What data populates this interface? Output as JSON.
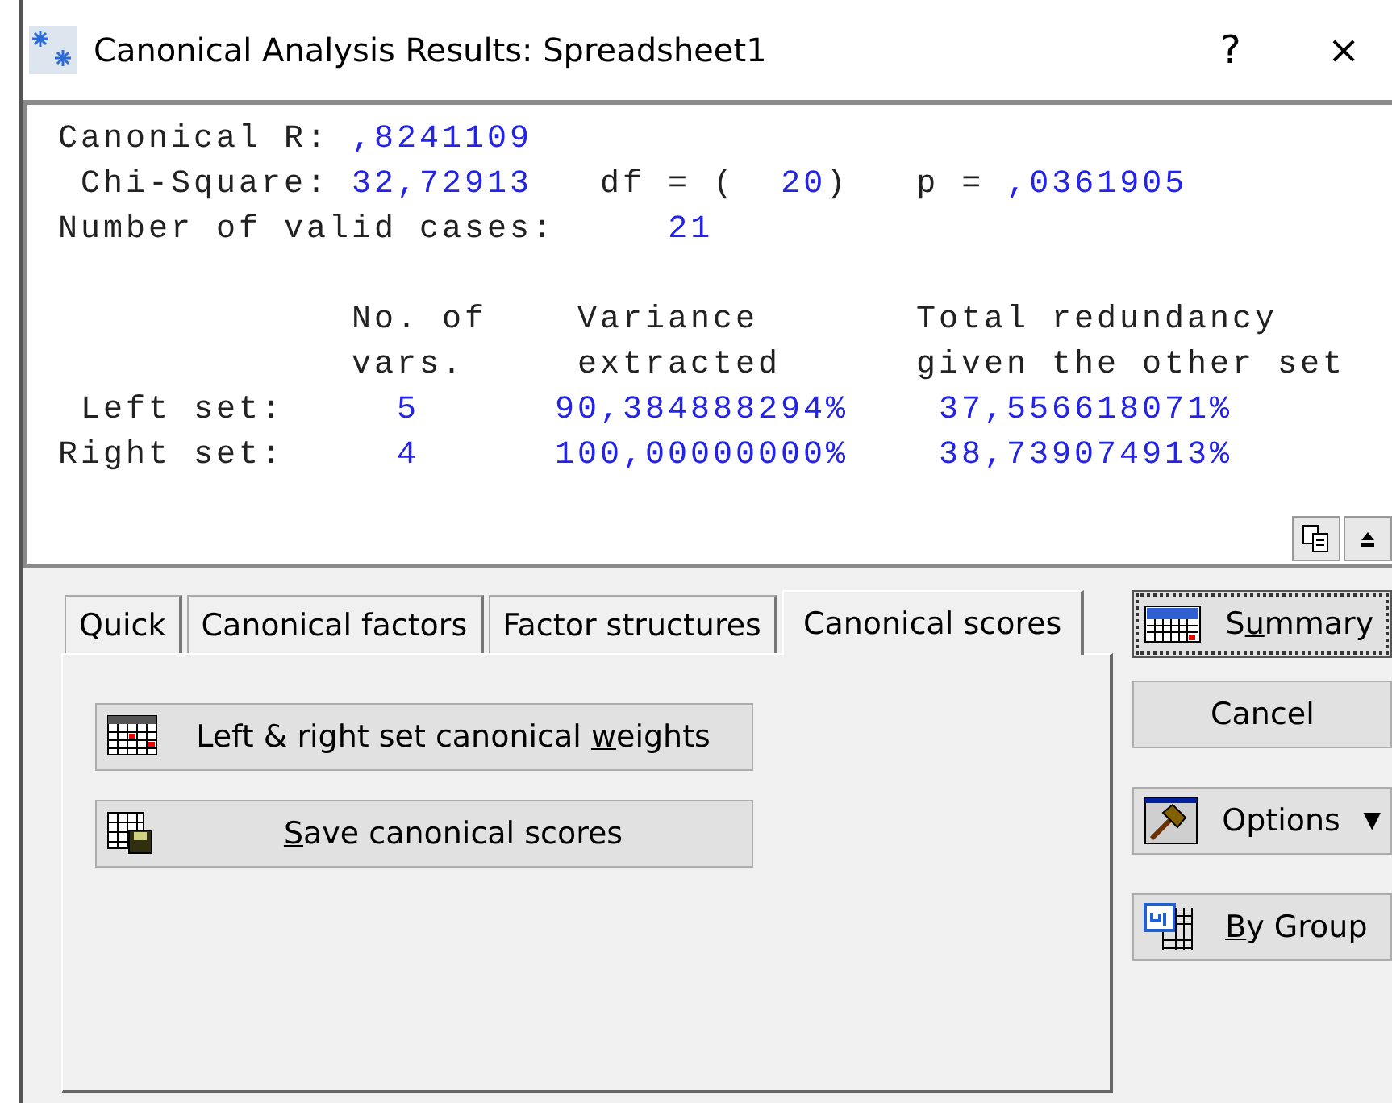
{
  "window": {
    "title": "Canonical Analysis Results: Spreadsheet1",
    "help": "?",
    "close": "×"
  },
  "output": {
    "lines": [
      {
        "segments": [
          {
            "text": "Canonical R: ",
            "kind": "label"
          },
          {
            "text": ",8241109",
            "kind": "value"
          }
        ]
      },
      {
        "segments": [
          {
            "text": " Chi-Square: ",
            "kind": "label"
          },
          {
            "text": "32,72913",
            "kind": "value"
          },
          {
            "text": "   df = (  ",
            "kind": "label"
          },
          {
            "text": "20",
            "kind": "value"
          },
          {
            "text": ")   p = ",
            "kind": "label"
          },
          {
            "text": ",0361905",
            "kind": "value"
          }
        ]
      },
      {
        "segments": [
          {
            "text": "Number of valid cases:     ",
            "kind": "label"
          },
          {
            "text": "21",
            "kind": "value"
          }
        ]
      }
    ],
    "table": {
      "header": [
        [
          "No. of",
          "vars."
        ],
        [
          "Variance",
          "extracted"
        ],
        [
          "Total redundancy",
          "given the other set"
        ]
      ],
      "rows": [
        {
          "label": "Left set:",
          "vars": "5",
          "variance": "90,384888294%",
          "redundancy": "37,556618071%"
        },
        {
          "label": "Right set:",
          "vars": "4",
          "variance": "100,00000000%",
          "redundancy": "38,739074913%"
        }
      ]
    }
  },
  "tabs": [
    {
      "label": "Quick",
      "selected": false
    },
    {
      "label": "Canonical factors",
      "selected": false
    },
    {
      "label": "Factor structures",
      "selected": false
    },
    {
      "label": "Canonical scores",
      "selected": true
    }
  ],
  "actions": [
    {
      "label_before": "Left & right set canonical ",
      "access_key": "w",
      "label_after": "eights",
      "kind": "grid"
    },
    {
      "access_key": "S",
      "label_after": "ave canonical scores",
      "kind": "save"
    }
  ],
  "side_buttons": [
    {
      "label_before": "S",
      "access_key": "u",
      "label_after": "mmary",
      "kind": "summary",
      "focused": true
    },
    {
      "label_before": "Cancel",
      "kind": "plain",
      "focused": false
    },
    {
      "label_before": "Options",
      "caret": "▼",
      "kind": "options",
      "focused": false
    },
    {
      "access_key": "B",
      "label_after": "y Group",
      "kind": "group",
      "focused": false
    }
  ]
}
